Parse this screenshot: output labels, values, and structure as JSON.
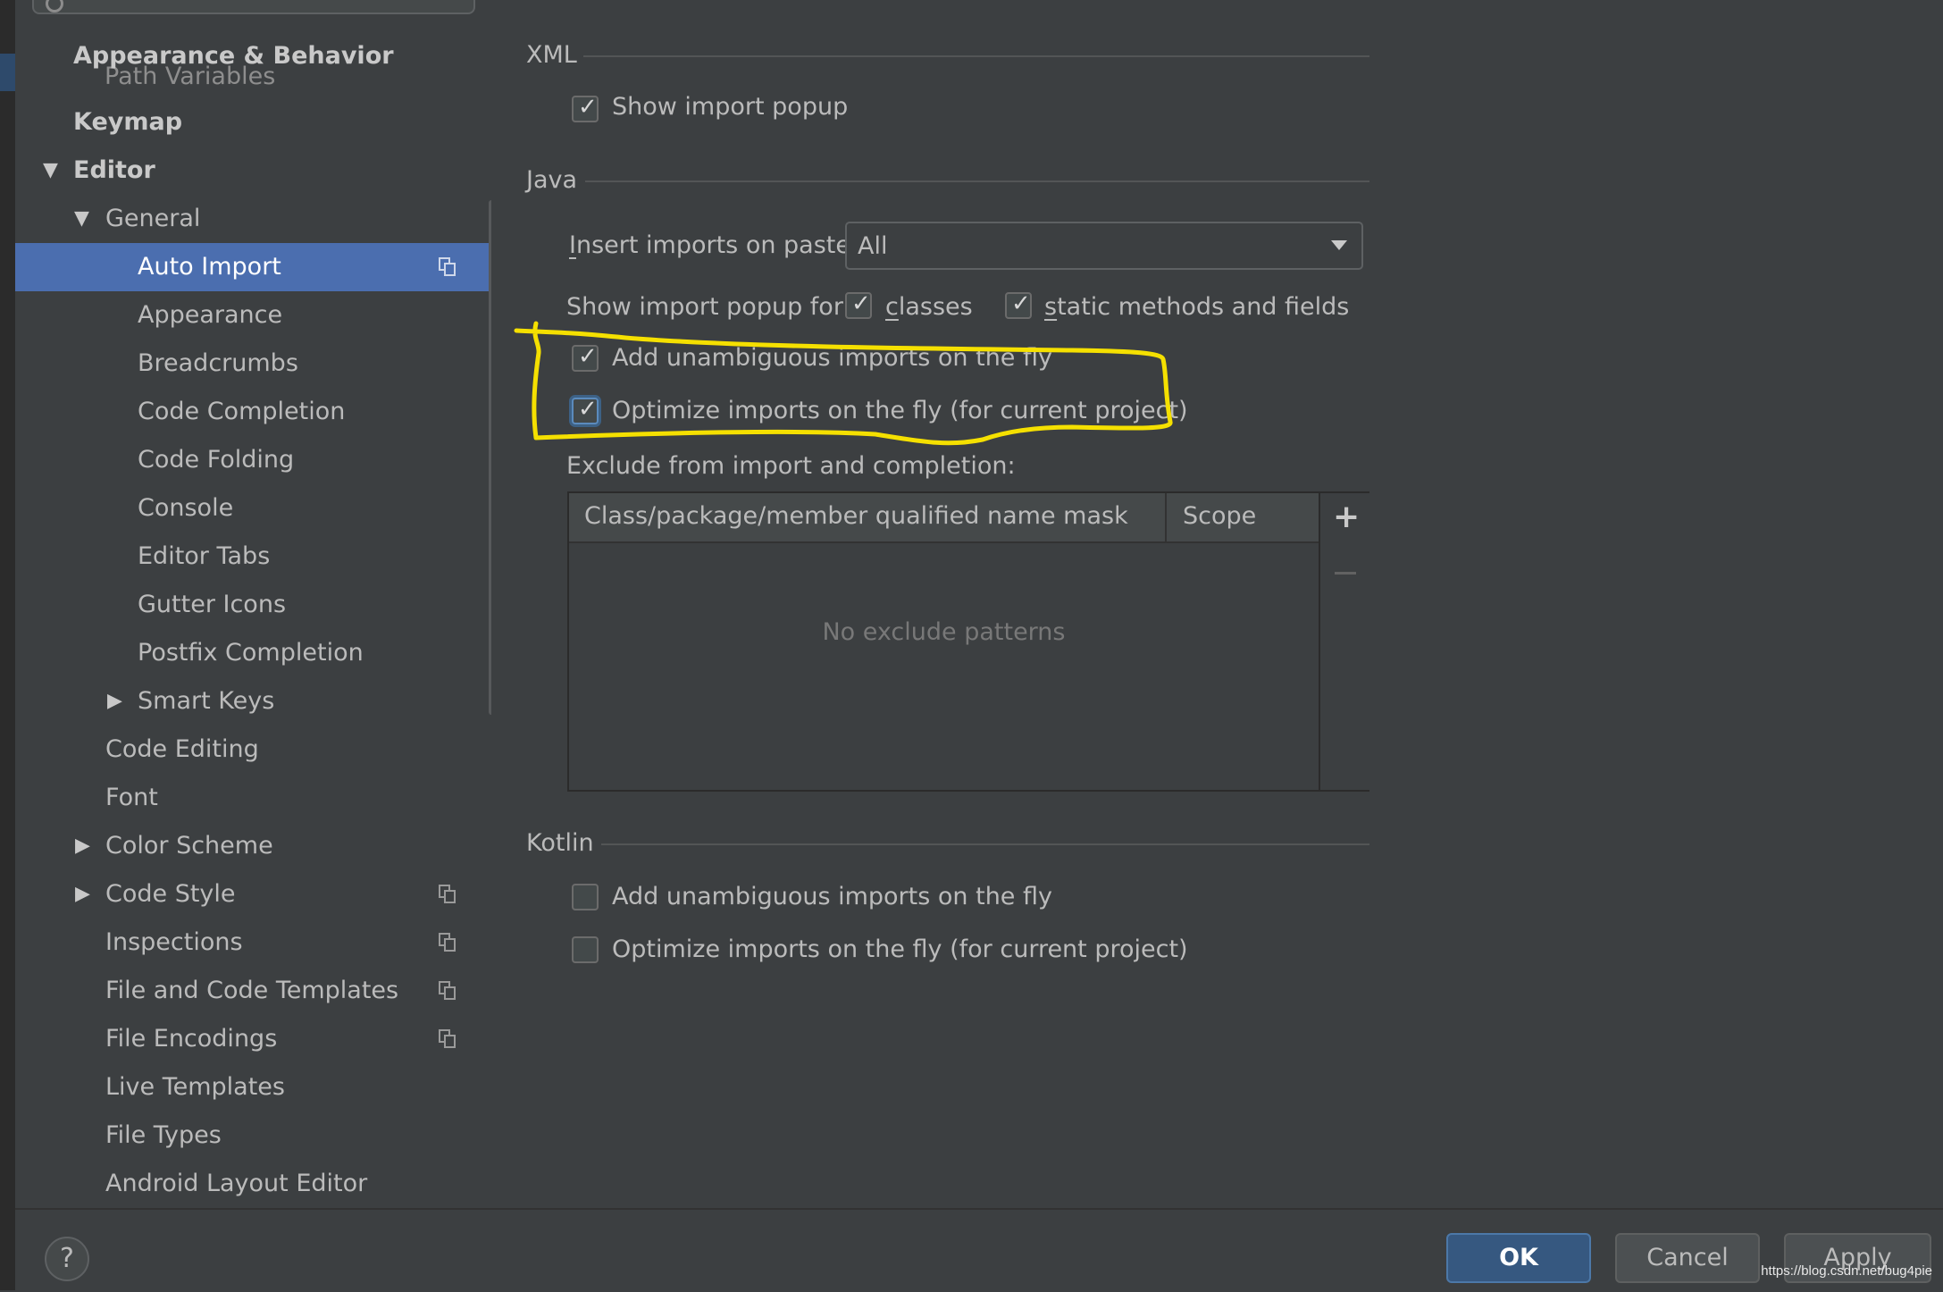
{
  "sidebar": {
    "ghost_item": "Path Variables",
    "items": [
      {
        "label": "Appearance & Behavior"
      },
      {
        "label": "Keymap"
      },
      {
        "label": "Editor"
      },
      {
        "label": "General"
      },
      {
        "label": "Auto Import"
      },
      {
        "label": "Appearance"
      },
      {
        "label": "Breadcrumbs"
      },
      {
        "label": "Code Completion"
      },
      {
        "label": "Code Folding"
      },
      {
        "label": "Console"
      },
      {
        "label": "Editor Tabs"
      },
      {
        "label": "Gutter Icons"
      },
      {
        "label": "Postfix Completion"
      },
      {
        "label": "Smart Keys"
      },
      {
        "label": "Code Editing"
      },
      {
        "label": "Font"
      },
      {
        "label": "Color Scheme"
      },
      {
        "label": "Code Style"
      },
      {
        "label": "Inspections"
      },
      {
        "label": "File and Code Templates"
      },
      {
        "label": "File Encodings"
      },
      {
        "label": "Live Templates"
      },
      {
        "label": "File Types"
      },
      {
        "label": "Android Layout Editor"
      }
    ]
  },
  "xml": {
    "title": "XML",
    "show_import_popup": {
      "label": "Show import popup",
      "checked": true
    }
  },
  "java": {
    "title": "Java",
    "insert_imports_label_first": "I",
    "insert_imports_label_rest": "nsert imports on paste:",
    "insert_imports_value": "All",
    "show_popup_for_label": "Show import popup for:",
    "classes_first": "c",
    "classes_rest": "lasses",
    "classes_checked": true,
    "static_first": "s",
    "static_rest": "tatic methods and fields",
    "static_checked": true,
    "add_unambiguous": {
      "label": "Add unambiguous imports on the fly",
      "checked": true
    },
    "optimize_imports": {
      "label": "Optimize imports on the fly (for current project)",
      "checked": true
    },
    "exclude_label": "Exclude from import and completion:",
    "table": {
      "columns": [
        "Class/package/member qualified name mask",
        "Scope"
      ],
      "empty_text": "No exclude patterns",
      "add_symbol": "+"
    }
  },
  "kotlin": {
    "title": "Kotlin",
    "add_unambiguous": {
      "label": "Add unambiguous imports on the fly",
      "checked": false
    },
    "optimize_imports": {
      "label": "Optimize imports on the fly (for current project)",
      "checked": false
    }
  },
  "footer": {
    "help": "?",
    "ok": "OK",
    "cancel": "Cancel",
    "apply": "Apply",
    "watermark": "https://blog.csdn.net/bug4pie"
  },
  "colors": {
    "background": "#3c3f41",
    "selection": "#4b6eaf",
    "ok_button": "#365880",
    "annotation": "#f5e000"
  }
}
